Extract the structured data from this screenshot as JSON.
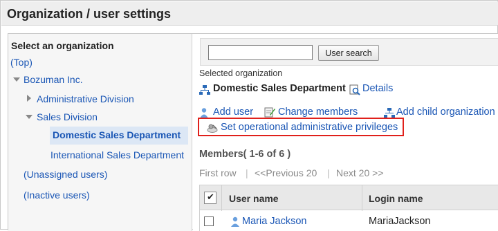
{
  "page": {
    "title": "Organization / user settings"
  },
  "left": {
    "heading": "Select an organization",
    "tree": {
      "top": "(Top)",
      "root": "Bozuman Inc.",
      "admin": "Administrative Division",
      "sales": "Sales Division",
      "domestic": "Domestic Sales Department",
      "international": "International Sales Department",
      "unassigned": "(Unassigned users)",
      "inactive": "(Inactive users)"
    }
  },
  "search": {
    "button_label": "User search",
    "value": ""
  },
  "selected": {
    "label": "Selected organization",
    "name": "Domestic Sales Department",
    "details_link": "Details"
  },
  "actions": {
    "add_user": "Add user",
    "change_members": "Change members",
    "add_child": "Add child organization",
    "set_privileges": "Set operational administrative privileges"
  },
  "members": {
    "title": "Members( 1-6 of 6 )",
    "pager": {
      "first": "First row",
      "prev": "<<Previous 20",
      "next": "Next 20 >>"
    },
    "columns": {
      "user_name": "User name",
      "login_name": "Login name"
    },
    "rows": [
      {
        "user_name": "Maria Jackson",
        "login_name": "MariaJackson"
      }
    ]
  },
  "colors": {
    "link": "#1a56b5",
    "highlight": "#e0201b",
    "selected_bg": "#dce7f5"
  }
}
